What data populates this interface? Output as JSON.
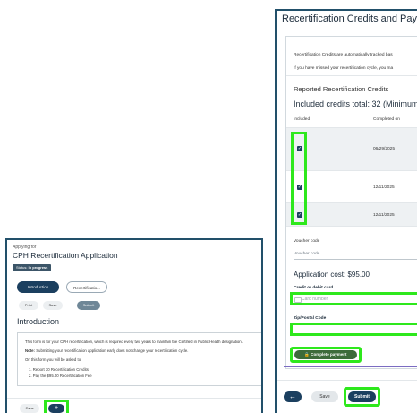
{
  "left": {
    "applying_for": "Applying for",
    "title": "CPH Recertification Application",
    "status_label": "Status:",
    "status_value": "In progress",
    "tabs": [
      "Introduction",
      "Recertificatio..."
    ],
    "buttons": {
      "print": "Print",
      "save": "Save",
      "submit": "Submit"
    },
    "heading": "Introduction",
    "body": {
      "line1": "This form is for your CPH recertification, which is required every two years to maintain the Certified in Public Health designation.",
      "note_label": "Note:",
      "note_text": "Submitting your recertification application early does not change your recertification cycle.",
      "asked": "On this form you will be asked to:",
      "items": [
        "1. Report 30 Recertification Credits",
        "2. Pay the $95.00 Recertification Fee"
      ]
    },
    "footer": {
      "save": "Save",
      "next_icon": "+"
    }
  },
  "right": {
    "title": "Recertification Credits and Payme",
    "info1": "Recertification Credits are automatically tracked bas",
    "info2": "If you have missed your recertification cycle, you ma",
    "reported_heading": "Reported Recertification Credits",
    "included_total": "Included credits total: 32 (Minimum",
    "columns": {
      "included": "Included",
      "completed_on": "Completed on"
    },
    "rows": [
      {
        "date": "06/29/2025",
        "checked": true
      },
      {
        "date": "12/11/2025",
        "checked": true
      },
      {
        "date": "12/11/2025",
        "checked": true
      }
    ],
    "voucher_label": "Voucher code",
    "voucher_placeholder": "Voucher code",
    "cost": "Application cost: $95.00",
    "card_label": "Credit or debit card",
    "card_placeholder": "Card number",
    "zip_label": "Zip/Postal Code",
    "pay_button": "Complete payment",
    "footer": {
      "back_icon": "←",
      "save": "Save",
      "submit": "Submit"
    }
  },
  "colors": {
    "highlight": "#2ee81c",
    "primary": "#1b3f5f",
    "pay": "#3d6b3b"
  }
}
